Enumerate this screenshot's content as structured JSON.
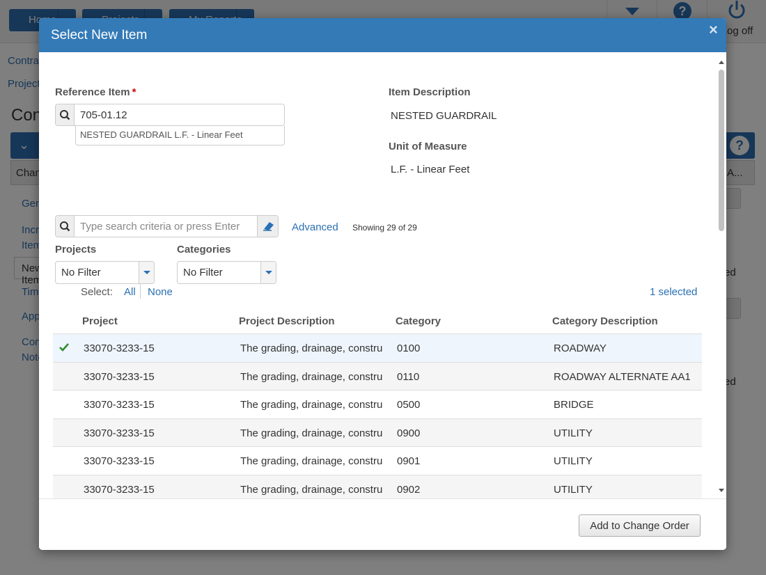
{
  "background": {
    "nav_buttons": [
      "Home",
      "Projects",
      "My Reports"
    ],
    "logoff_label": "Log off",
    "links": [
      "Contracts",
      "Projects"
    ],
    "heading": "Contract Modification",
    "side_items": [
      "General",
      "Increased Items",
      "New Items",
      "Time",
      "Approvals",
      "Contract Notes"
    ],
    "tab_label": "Change Order",
    "right_texts": [
      "ed",
      "ed"
    ],
    "right_tab": "A..."
  },
  "modal": {
    "title": "Select New Item",
    "close_symbol": "×",
    "reference_item": {
      "label": "Reference Item",
      "required_mark": "*",
      "value": "705-01.12",
      "suggestion": "NESTED GUARDRAIL L.F. - Linear Feet"
    },
    "item_description": {
      "label": "Item Description",
      "value": "NESTED GUARDRAIL"
    },
    "unit_of_measure": {
      "label": "Unit of Measure",
      "value": "L.F. - Linear Feet"
    },
    "search": {
      "placeholder": "Type search criteria or press Enter",
      "advanced_label": "Advanced",
      "showing_text": "Showing 29 of 29"
    },
    "filters": {
      "projects": {
        "label": "Projects",
        "value": "No Filter"
      },
      "categories": {
        "label": "Categories",
        "value": "No Filter"
      }
    },
    "select_controls": {
      "label": "Select:",
      "all": "All",
      "none": "None",
      "selected_count": "1 selected"
    },
    "table": {
      "columns": [
        "Project",
        "Project Description",
        "Category",
        "Category Description"
      ],
      "rows": [
        {
          "project": "33070-3233-15",
          "description": "The grading, drainage, construction",
          "category": "0100",
          "category_description": "ROADWAY",
          "selected": true
        },
        {
          "project": "33070-3233-15",
          "description": "The grading, drainage, construction",
          "category": "0110",
          "category_description": "ROADWAY ALTERNATE AA1",
          "selected": false
        },
        {
          "project": "33070-3233-15",
          "description": "The grading, drainage, construction",
          "category": "0500",
          "category_description": "BRIDGE",
          "selected": false
        },
        {
          "project": "33070-3233-15",
          "description": "The grading, drainage, construction",
          "category": "0900",
          "category_description": "UTILITY",
          "selected": false
        },
        {
          "project": "33070-3233-15",
          "description": "The grading, drainage, construction",
          "category": "0901",
          "category_description": "UTILITY",
          "selected": false
        },
        {
          "project": "33070-3233-15",
          "description": "The grading, drainage, construction",
          "category": "0902",
          "category_description": "UTILITY",
          "selected": false
        }
      ]
    },
    "footer": {
      "add_button": "Add to Change Order"
    }
  },
  "colors": {
    "header_blue": "#337ab7",
    "link_blue": "#2a70b3",
    "check_green": "#2e8b2e",
    "required_red": "#cc0000"
  },
  "icons": [
    "search-icon",
    "eraser-icon",
    "chevron-down-icon",
    "check-icon",
    "close-icon",
    "help-icon",
    "power-icon"
  ]
}
